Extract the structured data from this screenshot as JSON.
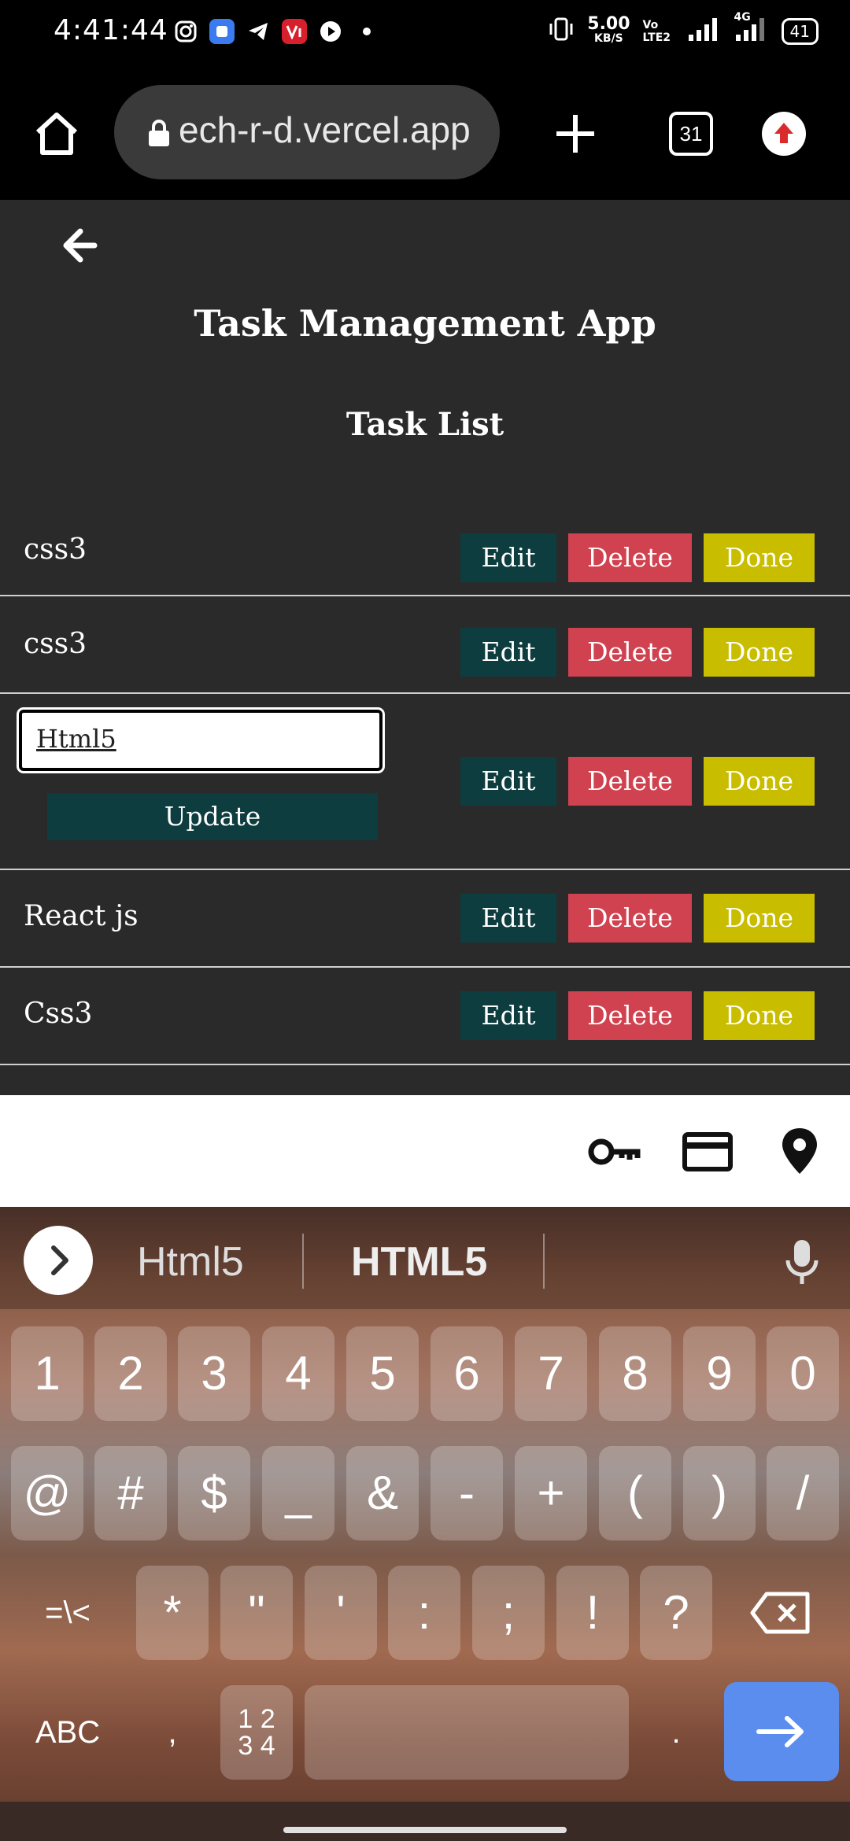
{
  "status_bar": {
    "time": "4:41:44",
    "network_speed_value": "5.00",
    "network_speed_unit": "KB/S",
    "volte": "Vo LTE2",
    "network_type": "4G",
    "battery": "41"
  },
  "browser": {
    "url": "ech-r-d.vercel.app",
    "tab_count": "31"
  },
  "app": {
    "title": "Task Management App",
    "list_title": "Task List",
    "tasks": [
      {
        "label": "css3"
      },
      {
        "label": "css3"
      },
      {
        "label": "Html5",
        "editing": true
      },
      {
        "label": "React js"
      },
      {
        "label": "Css3"
      }
    ],
    "buttons": {
      "edit": "Edit",
      "delete": "Delete",
      "done": "Done",
      "update": "Update"
    },
    "colors": {
      "background": "#2a2a2a",
      "edit": "#0e3d3f",
      "delete": "#d0424f",
      "done": "#c9bd00"
    }
  },
  "autofill_bar": {
    "icons": [
      "key-icon",
      "credit-card-icon",
      "location-pin-icon"
    ]
  },
  "keyboard": {
    "suggestions": [
      "Html5",
      "HTML5"
    ],
    "row1": [
      "1",
      "2",
      "3",
      "4",
      "5",
      "6",
      "7",
      "8",
      "9",
      "0"
    ],
    "row2": [
      "@",
      "#",
      "$",
      "_",
      "&",
      "-",
      "+",
      "(",
      ")",
      "/"
    ],
    "row3_left": "=\\<",
    "row3": [
      "*",
      "\"",
      "'",
      ":",
      ";",
      "!",
      "?"
    ],
    "row4_abc": "ABC",
    "row4_comma": ",",
    "row4_numpad_top": "1 2",
    "row4_numpad_bottom": "3 4",
    "row4_period": "."
  }
}
